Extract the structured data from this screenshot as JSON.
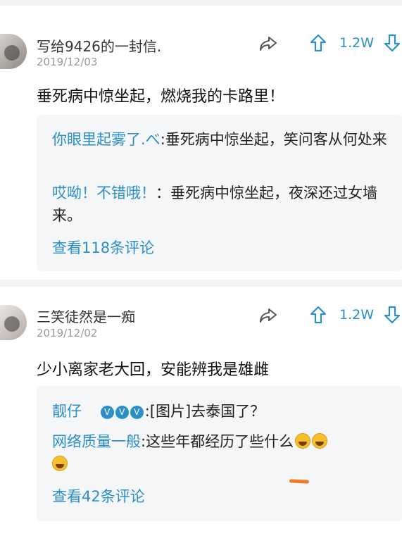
{
  "posts": [
    {
      "username": "写给9426的一封信.",
      "date": "2019/12/03",
      "like_count": "1.2W",
      "content": "垂死病中惊坐起，燃烧我的卡路里！",
      "replies": [
        {
          "nick": "你眼里起雾了.べ",
          "text": ":垂死病中惊坐起，笑问客从何处来"
        },
        {
          "nick": "哎呦！不错哦！",
          "text": "：垂死病中惊坐起，夜深还过女墙来。"
        }
      ],
      "more_link": "查看118条评论"
    },
    {
      "username": "三笑徒然是一痴",
      "date": "2019/12/02",
      "like_count": "1.2W",
      "content": "少小离家老大回，安能辨我是雄雌",
      "replies": [
        {
          "nick": "靓仔",
          "badges": [
            "V",
            "V",
            "V"
          ],
          "text": ":[图片]去泰国了？"
        },
        {
          "nick": "网络质量一般",
          "text": ":这些年都经历了些什么"
        }
      ],
      "more_link": "查看42条评论"
    }
  ],
  "colors": {
    "accent": "#2b8fc8",
    "reply_bg": "#f5f6f8",
    "date": "#9a9a9a"
  }
}
